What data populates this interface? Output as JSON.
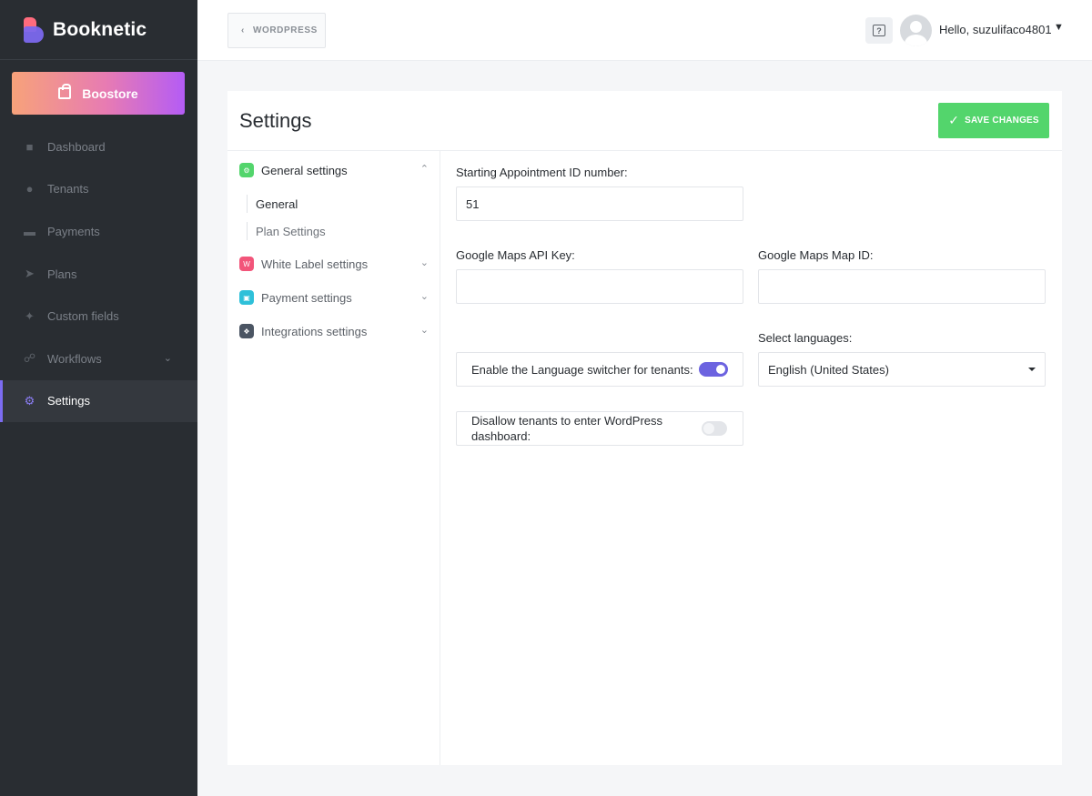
{
  "brand": {
    "name": "Booknetic"
  },
  "boostore": {
    "label": "Boostore",
    "icon": "shopping-bag-icon"
  },
  "sidebar": {
    "items": [
      {
        "label": "Dashboard",
        "icon": "cube-icon"
      },
      {
        "label": "Tenants",
        "icon": "user-icon"
      },
      {
        "label": "Payments",
        "icon": "credit-card-icon"
      },
      {
        "label": "Plans",
        "icon": "rocket-icon"
      },
      {
        "label": "Custom fields",
        "icon": "magic-wand-icon"
      },
      {
        "label": "Workflows",
        "icon": "workflow-icon"
      },
      {
        "label": "Settings",
        "icon": "gear-icon"
      }
    ],
    "active": "Settings"
  },
  "topbar": {
    "back_label": "WORDPRESS",
    "greeting": "Hello, suzulifaco4801"
  },
  "page": {
    "title": "Settings",
    "save_label": "SAVE CHANGES"
  },
  "settings_menu": {
    "groups": [
      {
        "label": "General settings",
        "color": "#53d56c",
        "expanded": true
      },
      {
        "label": "White Label settings",
        "color": "#f2557a",
        "expanded": false
      },
      {
        "label": "Payment settings",
        "color": "#2ec0d9",
        "expanded": false
      },
      {
        "label": "Integrations settings",
        "color": "#4b5563",
        "expanded": false
      }
    ],
    "general_subitems": [
      "General",
      "Plan Settings"
    ],
    "active_subitem": "General"
  },
  "form": {
    "start_id_label": "Starting Appointment ID number:",
    "start_id_value": "51",
    "maps_api_label": "Google Maps API Key:",
    "maps_api_value": "",
    "maps_id_label": "Google Maps Map ID:",
    "maps_id_value": "",
    "languages_label": "Select languages:",
    "languages_selected": "English (United States)",
    "lang_switcher_label": "Enable the Language switcher for tenants:",
    "lang_switcher_on": true,
    "disallow_wp_label": "Disallow tenants to enter WordPress dashboard:",
    "disallow_wp_on": false
  },
  "colors": {
    "accent": "#6c63e0",
    "save": "#53d56c",
    "sidebar_bg": "#292d32"
  }
}
